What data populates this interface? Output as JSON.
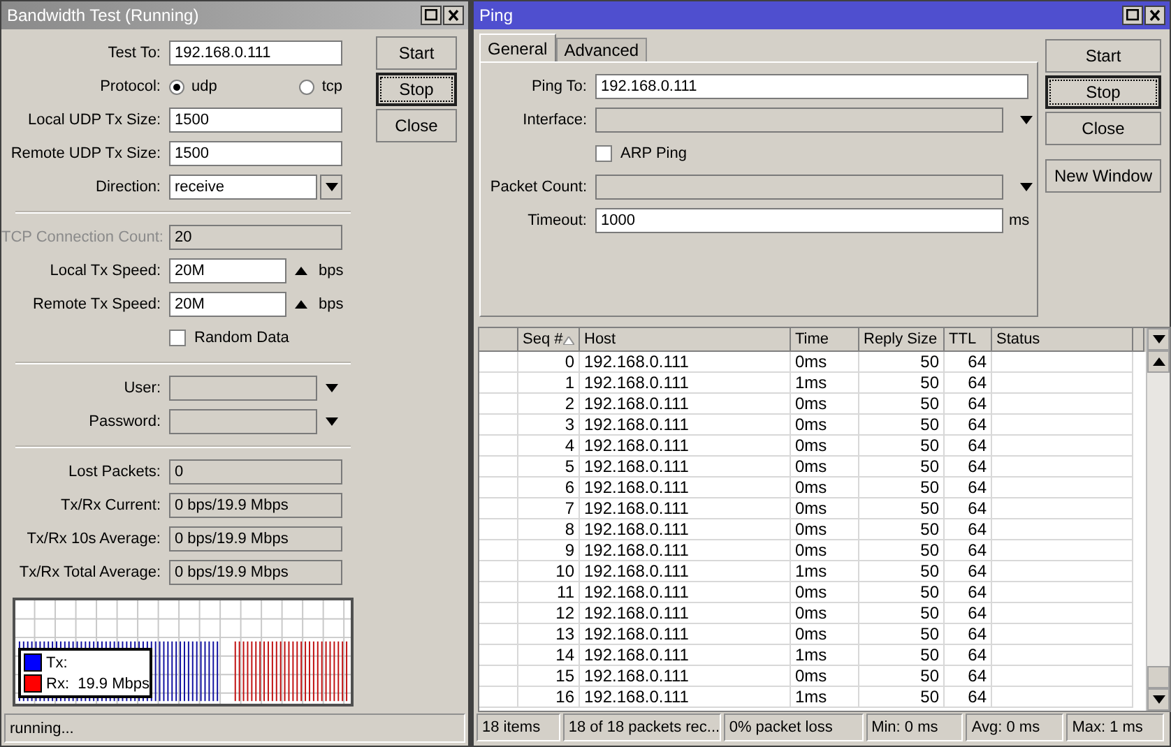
{
  "bandwidth_test": {
    "title": "Bandwidth Test (Running)",
    "fields": [
      {
        "kind": "text",
        "label": "Test To:",
        "value": "192.168.0.111"
      },
      {
        "kind": "radio",
        "label": "Protocol:",
        "options": [
          {
            "label": "udp",
            "selected": true
          },
          {
            "label": "tcp",
            "selected": false
          }
        ]
      },
      {
        "kind": "text",
        "label": "Local UDP Tx Size:",
        "value": "1500"
      },
      {
        "kind": "text",
        "label": "Remote UDP Tx Size:",
        "value": "1500"
      },
      {
        "kind": "select",
        "label": "Direction:",
        "value": "receive"
      },
      {
        "kind": "separator"
      },
      {
        "kind": "readonly",
        "label": "TCP Connection Count:",
        "value": "20",
        "disabled": true
      },
      {
        "kind": "speed",
        "label": "Local Tx Speed:",
        "value": "20M",
        "unit": "bps"
      },
      {
        "kind": "speed",
        "label": "Remote Tx Speed:",
        "value": "20M",
        "unit": "bps"
      },
      {
        "kind": "checkbox",
        "label": "Random Data",
        "checked": false
      },
      {
        "kind": "separator"
      },
      {
        "kind": "dropdown",
        "label": "User:"
      },
      {
        "kind": "dropdown",
        "label": "Password:"
      },
      {
        "kind": "separator"
      },
      {
        "kind": "readonly",
        "label": "Lost Packets:",
        "value": "0",
        "disabled": false
      },
      {
        "kind": "readonly",
        "label": "Tx/Rx Current:",
        "value": "0 bps/19.9 Mbps",
        "disabled": false
      },
      {
        "kind": "readonly",
        "label": "Tx/Rx 10s Average:",
        "value": "0 bps/19.9 Mbps",
        "disabled": false
      },
      {
        "kind": "readonly",
        "label": "Tx/Rx Total Average:",
        "value": "0 bps/19.9 Mbps",
        "disabled": false
      }
    ],
    "buttons": [
      {
        "label": "Start",
        "focused": false
      },
      {
        "label": "Stop",
        "focused": true
      },
      {
        "label": "Close",
        "focused": false
      }
    ],
    "legend": [
      {
        "label": "Tx:",
        "color": "#0000ff"
      },
      {
        "label": "Rx:  19.9 Mbps",
        "color": "#ff0000"
      }
    ],
    "status": "running..."
  },
  "ping": {
    "title": "Ping",
    "tabs": [
      {
        "label": "General",
        "selected": true
      },
      {
        "label": "Advanced",
        "selected": false
      }
    ],
    "fields": [
      {
        "kind": "text",
        "label": "Ping To:",
        "value": "192.168.0.111"
      },
      {
        "kind": "dropdown",
        "label": "Interface:"
      },
      {
        "kind": "checkbox",
        "label": "ARP Ping",
        "checked": false
      },
      {
        "kind": "dropdown",
        "label": "Packet Count:"
      },
      {
        "kind": "unit",
        "label": "Timeout:",
        "value": "1000",
        "unit": "ms"
      }
    ],
    "buttons": [
      {
        "label": "Start",
        "focused": false
      },
      {
        "label": "Stop",
        "focused": true
      },
      {
        "label": "Close",
        "focused": false
      },
      {
        "label": "New Window",
        "focused": false
      }
    ],
    "table": {
      "columns": [
        {
          "label": "Seq #",
          "sorted": true
        },
        {
          "label": "Host",
          "sorted": false
        },
        {
          "label": "Time",
          "sorted": false
        },
        {
          "label": "Reply Size",
          "sorted": false
        },
        {
          "label": "TTL",
          "sorted": false
        },
        {
          "label": "Status",
          "sorted": false
        }
      ],
      "rows": [
        {
          "seq": "0",
          "host": "192.168.0.111",
          "time": "0ms",
          "reply_size": "50",
          "ttl": "64"
        },
        {
          "seq": "1",
          "host": "192.168.0.111",
          "time": "1ms",
          "reply_size": "50",
          "ttl": "64"
        },
        {
          "seq": "2",
          "host": "192.168.0.111",
          "time": "0ms",
          "reply_size": "50",
          "ttl": "64"
        },
        {
          "seq": "3",
          "host": "192.168.0.111",
          "time": "0ms",
          "reply_size": "50",
          "ttl": "64"
        },
        {
          "seq": "4",
          "host": "192.168.0.111",
          "time": "0ms",
          "reply_size": "50",
          "ttl": "64"
        },
        {
          "seq": "5",
          "host": "192.168.0.111",
          "time": "0ms",
          "reply_size": "50",
          "ttl": "64"
        },
        {
          "seq": "6",
          "host": "192.168.0.111",
          "time": "0ms",
          "reply_size": "50",
          "ttl": "64"
        },
        {
          "seq": "7",
          "host": "192.168.0.111",
          "time": "0ms",
          "reply_size": "50",
          "ttl": "64"
        },
        {
          "seq": "8",
          "host": "192.168.0.111",
          "time": "0ms",
          "reply_size": "50",
          "ttl": "64"
        },
        {
          "seq": "9",
          "host": "192.168.0.111",
          "time": "0ms",
          "reply_size": "50",
          "ttl": "64"
        },
        {
          "seq": "10",
          "host": "192.168.0.111",
          "time": "1ms",
          "reply_size": "50",
          "ttl": "64"
        },
        {
          "seq": "11",
          "host": "192.168.0.111",
          "time": "0ms",
          "reply_size": "50",
          "ttl": "64"
        },
        {
          "seq": "12",
          "host": "192.168.0.111",
          "time": "0ms",
          "reply_size": "50",
          "ttl": "64"
        },
        {
          "seq": "13",
          "host": "192.168.0.111",
          "time": "0ms",
          "reply_size": "50",
          "ttl": "64"
        },
        {
          "seq": "14",
          "host": "192.168.0.111",
          "time": "1ms",
          "reply_size": "50",
          "ttl": "64"
        },
        {
          "seq": "15",
          "host": "192.168.0.111",
          "time": "0ms",
          "reply_size": "50",
          "ttl": "64"
        },
        {
          "seq": "16",
          "host": "192.168.0.111",
          "time": "1ms",
          "reply_size": "50",
          "ttl": "64"
        }
      ]
    },
    "status_bar": [
      "18 items",
      "18 of 18 packets rec...",
      "0% packet loss",
      "Min: 0 ms",
      "Avg: 0 ms",
      "Max: 1 ms"
    ]
  }
}
